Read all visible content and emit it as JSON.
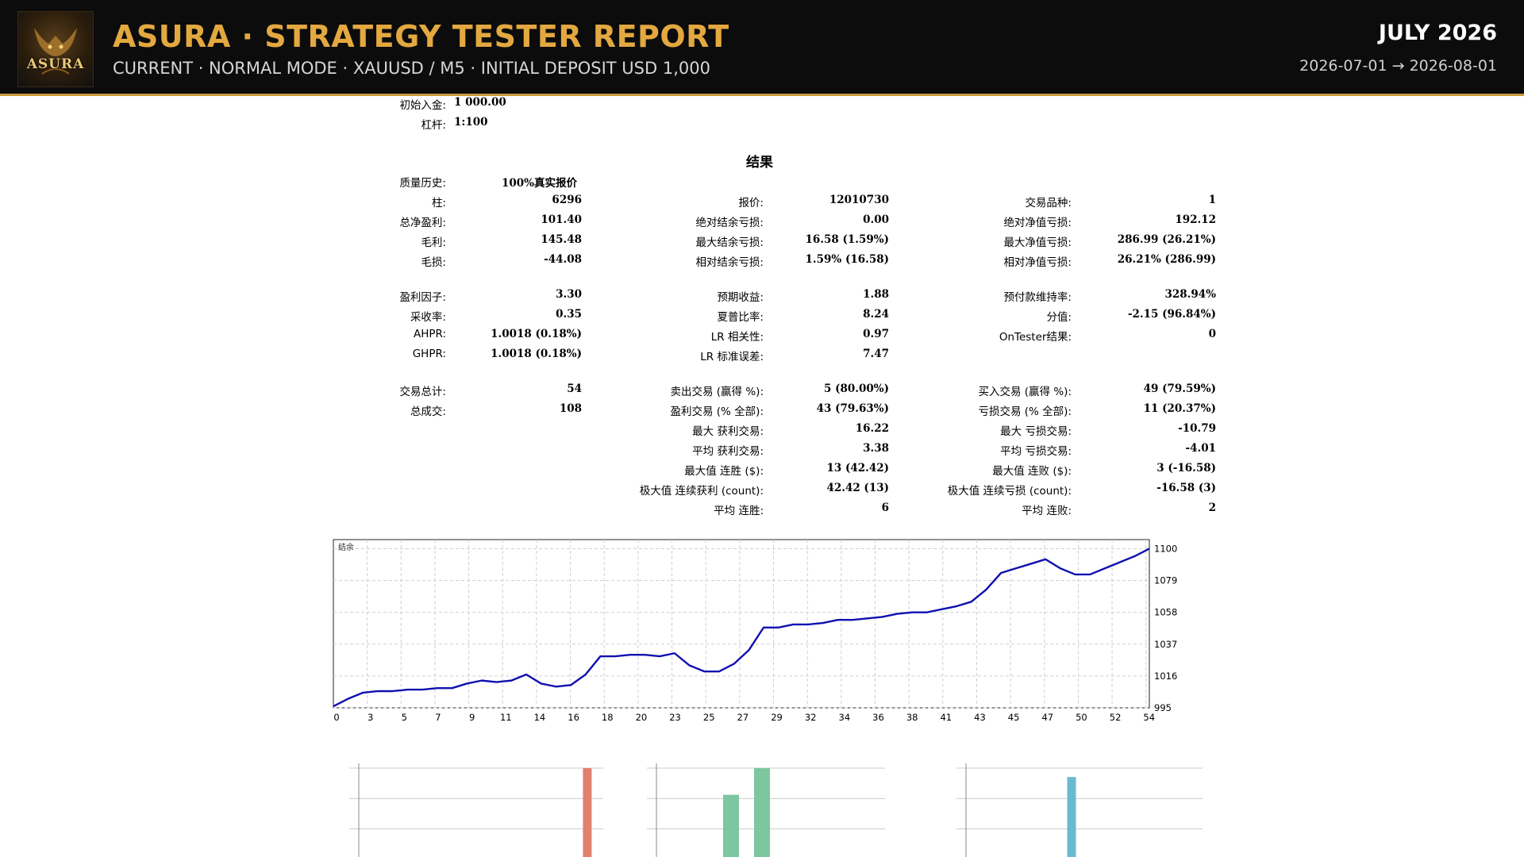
{
  "header": {
    "logo_text": "ASURA",
    "title": "ASURA · STRATEGY TESTER REPORT",
    "subtitle": "CURRENT · NORMAL MODE · XAUUSD / M5 · INITIAL DEPOSIT USD 1,000",
    "month": "JULY 2026",
    "range": "2026-07-01 → 2026-08-01",
    "accent_color": "#e3a83f"
  },
  "settings": {
    "deposit_label": "初始入金:",
    "deposit_value": "1 000.00",
    "leverage_label": "杠杆:",
    "leverage_value": "1:100"
  },
  "results_title": "结果",
  "metrics": {
    "history_quality": {
      "label": "质量历史:",
      "value": "100%真实报价"
    },
    "bars": {
      "label": "柱:",
      "value": "6296"
    },
    "ticks": {
      "label": "报价:",
      "value": "12010730"
    },
    "symbols": {
      "label": "交易品种:",
      "value": "1"
    },
    "net_profit": {
      "label": "总净盈利:",
      "value": "101.40"
    },
    "bal_dd_abs": {
      "label": "绝对结余亏损:",
      "value": "0.00"
    },
    "eq_dd_abs": {
      "label": "绝对净值亏损:",
      "value": "192.12"
    },
    "gross_profit": {
      "label": "毛利:",
      "value": "145.48"
    },
    "bal_dd_max": {
      "label": "最大结余亏损:",
      "value": "16.58 (1.59%)"
    },
    "eq_dd_max": {
      "label": "最大净值亏损:",
      "value": "286.99 (26.21%)"
    },
    "gross_loss": {
      "label": "毛损:",
      "value": "-44.08"
    },
    "bal_dd_rel": {
      "label": "相对结余亏损:",
      "value": "1.59% (16.58)"
    },
    "eq_dd_rel": {
      "label": "相对净值亏损:",
      "value": "26.21% (286.99)"
    },
    "profit_factor": {
      "label": "盈利因子:",
      "value": "3.30"
    },
    "expected_payoff": {
      "label": "预期收益:",
      "value": "1.88"
    },
    "margin_level": {
      "label": "预付款维持率:",
      "value": "328.94%"
    },
    "recovery_factor": {
      "label": "采收率:",
      "value": "0.35"
    },
    "sharpe": {
      "label": "夏普比率:",
      "value": "8.24"
    },
    "z_score": {
      "label": "分值:",
      "value": "-2.15 (96.84%)"
    },
    "ahpr": {
      "label": "AHPR:",
      "value": "1.0018 (0.18%)"
    },
    "lr_corr": {
      "label": "LR 相关性:",
      "value": "0.97"
    },
    "ontester": {
      "label": "OnTester结果:",
      "value": "0"
    },
    "ghpr": {
      "label": "GHPR:",
      "value": "1.0018 (0.18%)"
    },
    "lr_err": {
      "label": "LR 标准误差:",
      "value": "7.47"
    },
    "total_trades": {
      "label": "交易总计:",
      "value": "54"
    },
    "short_trades": {
      "label": "卖出交易 (赢得 %):",
      "value": "5 (80.00%)"
    },
    "long_trades": {
      "label": "买入交易 (赢得 %):",
      "value": "49 (79.59%)"
    },
    "total_deals": {
      "label": "总成交:",
      "value": "108"
    },
    "profit_trades": {
      "label": "盈利交易 (% 全部):",
      "value": "43 (79.63%)"
    },
    "loss_trades": {
      "label": "亏损交易 (% 全部):",
      "value": "11 (20.37%)"
    },
    "largest_profit": {
      "label": "最大 获利交易:",
      "value": "16.22"
    },
    "largest_loss": {
      "label": "最大 亏损交易:",
      "value": "-10.79"
    },
    "avg_profit": {
      "label": "平均 获利交易:",
      "value": "3.38"
    },
    "avg_loss": {
      "label": "平均 亏损交易:",
      "value": "-4.01"
    },
    "max_cons_wins": {
      "label": "最大值 连胜 ($):",
      "value": "13 (42.42)"
    },
    "max_cons_losses": {
      "label": "最大值 连败 ($):",
      "value": "3 (-16.58)"
    },
    "max_cons_profit": {
      "label": "极大值 连续获利 (count):",
      "value": "42.42 (13)"
    },
    "max_cons_loss": {
      "label": "极大值 连续亏损 (count):",
      "value": "-16.58 (3)"
    },
    "avg_cons_wins": {
      "label": "平均 连胜:",
      "value": "6"
    },
    "avg_cons_losses": {
      "label": "平均 连败:",
      "value": "2"
    }
  },
  "chart_data": [
    {
      "type": "line",
      "title": "结余",
      "x": [
        0,
        1,
        2,
        3,
        4,
        5,
        6,
        7,
        8,
        9,
        10,
        11,
        12,
        13,
        14,
        15,
        16,
        17,
        18,
        19,
        20,
        21,
        22,
        23,
        24,
        25,
        26,
        27,
        28,
        29,
        30,
        31,
        32,
        33,
        34,
        35,
        36,
        37,
        38,
        39,
        40,
        41,
        42,
        43,
        44,
        45,
        46,
        47,
        48,
        49,
        50,
        51,
        52,
        53,
        54,
        55
      ],
      "x_tick_labels": [
        "0",
        "3",
        "5",
        "7",
        "9",
        "11",
        "14",
        "16",
        "18",
        "20",
        "23",
        "25",
        "27",
        "29",
        "32",
        "34",
        "36",
        "38",
        "41",
        "43",
        "45",
        "47",
        "50",
        "52",
        "54"
      ],
      "y_tick_labels": [
        "1100",
        "1079",
        "1058",
        "1037",
        "1016",
        "995"
      ],
      "ylim": [
        995,
        1106
      ],
      "grid": true,
      "series": [
        {
          "color": "#1010b0",
          "values": [
            996,
            1001,
            1005,
            1006,
            1006,
            1007,
            1007,
            1008,
            1008,
            1011,
            1013,
            1012,
            1013,
            1017,
            1011,
            1009,
            1010,
            1017,
            1029,
            1029,
            1030,
            1030,
            1029,
            1031,
            1023,
            1019,
            1019,
            1024,
            1033,
            1048,
            1048,
            1050,
            1050,
            1051,
            1053,
            1053,
            1054,
            1055,
            1057,
            1058,
            1058,
            1060,
            1062,
            1065,
            1073,
            1084,
            1087,
            1090,
            1093,
            1087,
            1083,
            1083,
            1087,
            1091,
            1095,
            1100
          ]
        }
      ]
    },
    {
      "type": "bar",
      "title": "",
      "series": [
        {
          "color": "#e0806e",
          "values": [
            0,
            1
          ]
        }
      ]
    },
    {
      "type": "bar",
      "title": "",
      "series": [
        {
          "color": "#7cc6a0",
          "values": [
            0,
            0.7,
            1
          ]
        }
      ]
    },
    {
      "type": "bar",
      "title": "",
      "series": [
        {
          "color": "#6ab9d0",
          "values": [
            0,
            0.9
          ]
        }
      ]
    }
  ]
}
